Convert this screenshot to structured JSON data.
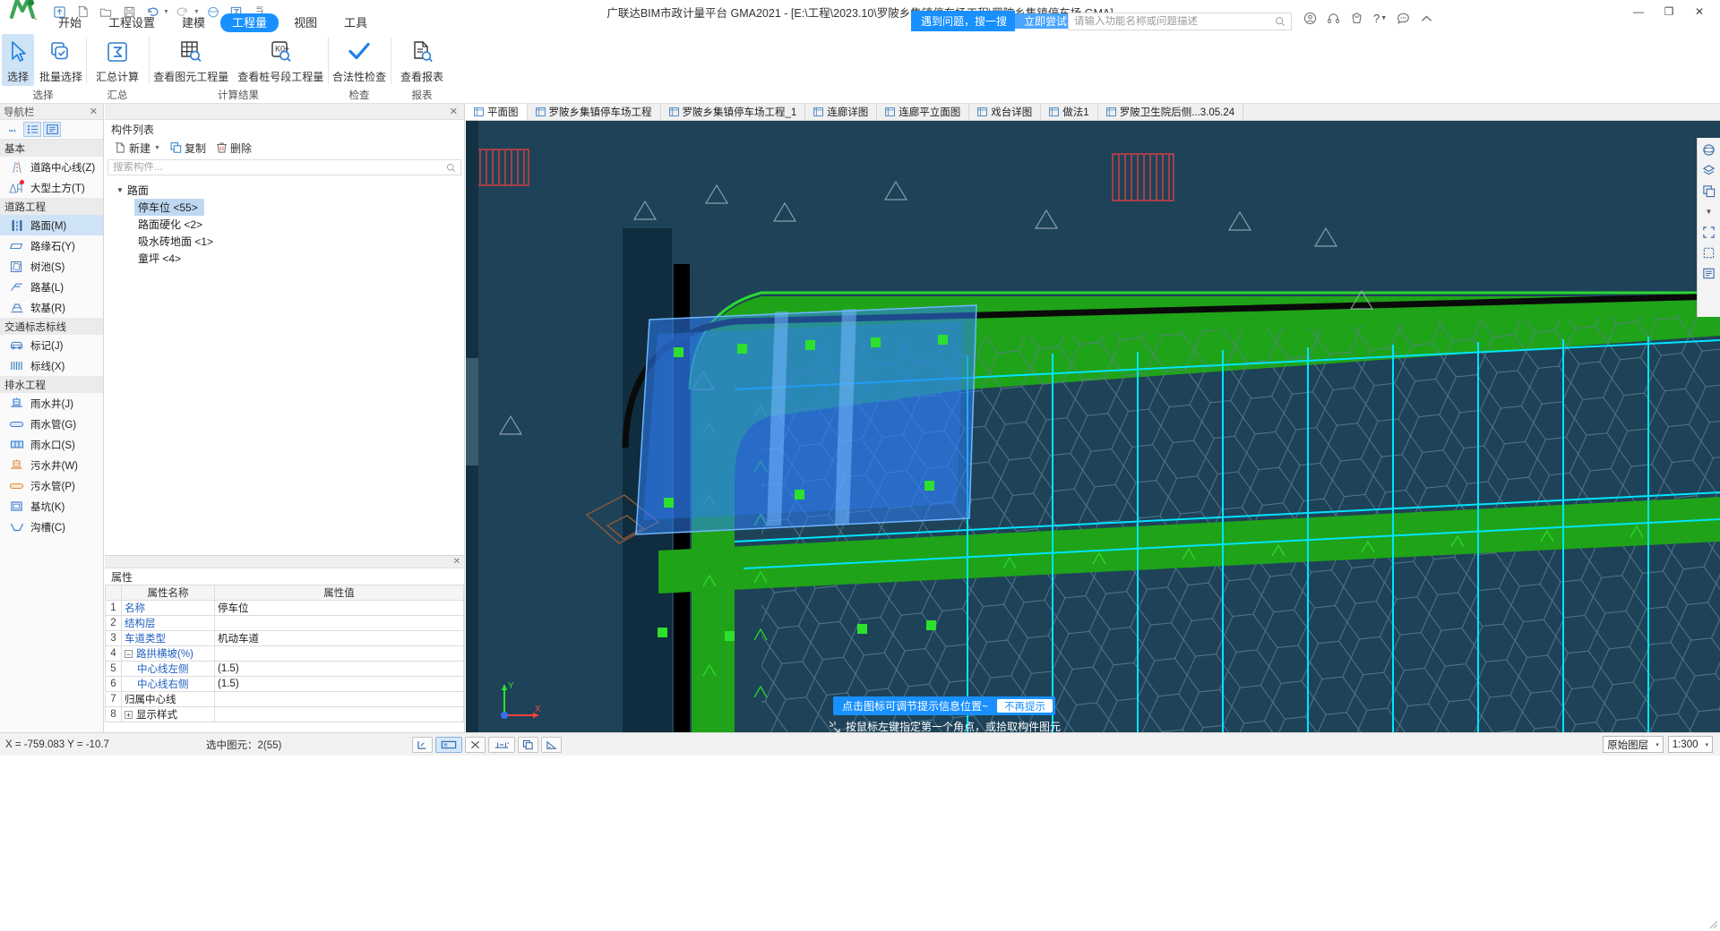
{
  "window": {
    "title": "广联达BIM市政计量平台 GMA2021 - [E:\\工程\\2023.10\\罗陂乡集镇停车场工程\\罗陂乡集镇停车场.GMA]",
    "minimize": "—",
    "maximize": "❐",
    "close": "✕"
  },
  "quick_access": [
    {
      "name": "upload-icon",
      "glyph": "⬆"
    },
    {
      "name": "new-file-icon",
      "glyph": "🗋"
    },
    {
      "name": "open-folder-icon",
      "glyph": "🗀"
    },
    {
      "name": "save-icon",
      "glyph": "💾"
    },
    {
      "name": "undo-icon",
      "glyph": "↺"
    },
    {
      "name": "redo-icon",
      "glyph": "↻"
    },
    {
      "name": "cloud-icon",
      "glyph": "◉"
    },
    {
      "name": "sum-icon",
      "glyph": "Σ"
    },
    {
      "name": "more-icon",
      "glyph": "⌄"
    }
  ],
  "menu": {
    "items": [
      {
        "label": "开始",
        "active": false
      },
      {
        "label": "工程设置",
        "active": false
      },
      {
        "label": "建模",
        "active": false
      },
      {
        "label": "工程量",
        "active": true
      },
      {
        "label": "视图",
        "active": false
      },
      {
        "label": "工具",
        "active": false
      }
    ]
  },
  "promo": {
    "text": "遇到问题，搜一搜",
    "button": "立即尝试"
  },
  "search": {
    "placeholder": "请输入功能名称或问题描述",
    "value": "",
    "icon": "search-icon"
  },
  "header_icons": [
    {
      "name": "user-account-icon",
      "glyph": "◎"
    },
    {
      "name": "headset-support-icon",
      "glyph": "⌾"
    },
    {
      "name": "gift-icon",
      "glyph": "♕"
    },
    {
      "name": "help-icon",
      "glyph": "?"
    },
    {
      "name": "feedback-icon",
      "glyph": "☺"
    },
    {
      "name": "collapse-ribbon-icon",
      "glyph": "⌃"
    }
  ],
  "ribbon": {
    "groups": [
      {
        "label": "选择",
        "buttons": [
          {
            "label": "选择",
            "icon": "cursor-arrow-icon",
            "selected": true
          },
          {
            "label": "批量选择",
            "icon": "batch-select-icon",
            "selected": false
          }
        ]
      },
      {
        "label": "汇总",
        "buttons": [
          {
            "label": "汇总计算",
            "icon": "sigma-calc-icon",
            "selected": false
          }
        ]
      },
      {
        "label": "计算结果",
        "buttons": [
          {
            "label": "查看图元工程量",
            "icon": "grid-search-icon",
            "selected": false
          },
          {
            "label": "查看桩号段工程量",
            "icon": "station-search-icon",
            "selected": false
          }
        ]
      },
      {
        "label": "检查",
        "buttons": [
          {
            "label": "合法性检查",
            "icon": "checkmark-icon",
            "selected": false
          }
        ]
      },
      {
        "label": "报表",
        "buttons": [
          {
            "label": "查看报表",
            "icon": "report-search-icon",
            "selected": false
          }
        ]
      }
    ]
  },
  "navigation": {
    "panel_title": "导航栏",
    "close_icon": "close-icon",
    "toolbar": [
      {
        "name": "collapse-all-icon",
        "glyph": "⎯",
        "active": false
      },
      {
        "name": "list-view-icon",
        "glyph": "☰",
        "active": true
      },
      {
        "name": "detail-view-icon",
        "glyph": "▤",
        "active": true
      }
    ],
    "sections": [
      {
        "title": "基本",
        "items": [
          {
            "label": "道路中心线(Z)",
            "icon": "road-centerline-icon",
            "selected": false,
            "badge": false
          },
          {
            "label": "大型土方(T)",
            "icon": "earthwork-icon",
            "selected": false,
            "badge": true
          }
        ]
      },
      {
        "title": "道路工程",
        "items": [
          {
            "label": "路面(M)",
            "icon": "pavement-icon",
            "selected": true,
            "badge": false
          },
          {
            "label": "路缘石(Y)",
            "icon": "curbstone-icon",
            "selected": false,
            "badge": false
          },
          {
            "label": "树池(S)",
            "icon": "tree-pit-icon",
            "selected": false,
            "badge": false
          },
          {
            "label": "路基(L)",
            "icon": "subgrade-icon",
            "selected": false,
            "badge": false
          },
          {
            "label": "软基(R)",
            "icon": "soft-foundation-icon",
            "selected": false,
            "badge": false
          }
        ]
      },
      {
        "title": "交通标志标线",
        "items": [
          {
            "label": "标记(J)",
            "icon": "traffic-sign-icon",
            "selected": false,
            "badge": false
          },
          {
            "label": "标线(X)",
            "icon": "road-marking-icon",
            "selected": false,
            "badge": false
          }
        ]
      },
      {
        "title": "排水工程",
        "items": [
          {
            "label": "雨水井(J)",
            "icon": "rain-manhole-icon",
            "selected": false,
            "badge": false
          },
          {
            "label": "雨水管(G)",
            "icon": "rain-pipe-icon",
            "selected": false,
            "badge": false
          },
          {
            "label": "雨水口(S)",
            "icon": "rain-inlet-icon",
            "selected": false,
            "badge": false
          },
          {
            "label": "污水井(W)",
            "icon": "sewer-manhole-icon",
            "selected": false,
            "badge": false
          },
          {
            "label": "污水管(P)",
            "icon": "sewer-pipe-icon",
            "selected": false,
            "badge": false
          },
          {
            "label": "基坑(K)",
            "icon": "foundation-pit-icon",
            "selected": false,
            "badge": false
          },
          {
            "label": "沟槽(C)",
            "icon": "trench-icon",
            "selected": false,
            "badge": false
          }
        ]
      }
    ]
  },
  "component_list": {
    "panel_title": "构件列表",
    "close_icon": "close-icon",
    "tools": [
      {
        "label": "新建",
        "icon": "new-component-icon",
        "has_caret": true
      },
      {
        "label": "复制",
        "icon": "copy-icon",
        "has_caret": false
      },
      {
        "label": "删除",
        "icon": "delete-icon",
        "has_caret": false
      }
    ],
    "search_placeholder": "搜索构件...",
    "search_value": "",
    "tree": [
      {
        "label": "路面",
        "expanded": true,
        "children": [
          {
            "label": "停车位  <55>",
            "selected": true
          },
          {
            "label": "路面硬化  <2>",
            "selected": false
          },
          {
            "label": "吸水砖地面  <1>",
            "selected": false
          },
          {
            "label": "童坪  <4>",
            "selected": false
          }
        ]
      }
    ]
  },
  "properties": {
    "panel_title": "属性",
    "close_icon": "close-icon",
    "columns": [
      "",
      "属性名称",
      "属性值"
    ],
    "rows": [
      {
        "no": "1",
        "name": "名称",
        "value": "停车位",
        "indent": 0,
        "link": true,
        "expander": ""
      },
      {
        "no": "2",
        "name": "结构层",
        "value": "",
        "indent": 0,
        "link": true,
        "expander": ""
      },
      {
        "no": "3",
        "name": "车道类型",
        "value": "机动车道",
        "indent": 0,
        "link": true,
        "expander": ""
      },
      {
        "no": "4",
        "name": "路拱横坡(%)",
        "value": "",
        "indent": 0,
        "link": true,
        "expander": "−"
      },
      {
        "no": "5",
        "name": "中心线左侧",
        "value": "(1.5)",
        "indent": 1,
        "link": true,
        "expander": ""
      },
      {
        "no": "6",
        "name": "中心线右侧",
        "value": "(1.5)",
        "indent": 1,
        "link": true,
        "expander": ""
      },
      {
        "no": "7",
        "name": "归属中心线",
        "value": "",
        "indent": 0,
        "link": false,
        "expander": ""
      },
      {
        "no": "8",
        "name": "显示样式",
        "value": "",
        "indent": 0,
        "link": false,
        "expander": "+"
      }
    ]
  },
  "document_tabs": [
    {
      "label": "平面图",
      "active": true,
      "icon": "drawing-icon"
    },
    {
      "label": "罗陂乡集镇停车场工程",
      "active": false,
      "icon": "drawing-icon"
    },
    {
      "label": "罗陂乡集镇停车场工程_1",
      "active": false,
      "icon": "drawing-icon"
    },
    {
      "label": "连廊详图",
      "active": false,
      "icon": "drawing-icon"
    },
    {
      "label": "连廊平立面图",
      "active": false,
      "icon": "drawing-icon"
    },
    {
      "label": "戏台详图",
      "active": false,
      "icon": "drawing-icon"
    },
    {
      "label": "做法1",
      "active": false,
      "icon": "drawing-icon"
    },
    {
      "label": "罗陂卫生院后侧...3.05.24",
      "active": false,
      "icon": "drawing-icon"
    }
  ],
  "viewport_tools": [
    {
      "name": "orbit-icon",
      "glyph": "◍"
    },
    {
      "name": "layer-icon",
      "glyph": "▤"
    },
    {
      "name": "copy-view-icon",
      "glyph": "❐"
    },
    {
      "name": "more-view-icon",
      "glyph": "⌄"
    },
    {
      "name": "fit-icon",
      "glyph": "⛶"
    },
    {
      "name": "zoom-window-icon",
      "glyph": "⬚"
    },
    {
      "name": "legend-icon",
      "glyph": "☰"
    }
  ],
  "canvas_hint": {
    "message": "点击图标可调节提示信息位置~",
    "dismiss": "不再提示",
    "command": "按鼠标左键指定第一个角点，或拾取构件图元",
    "command_icon": "crosshair-icon"
  },
  "status_bar": {
    "coordinates": "X = -759.083  Y = -10.7",
    "selection": "选中图元：2(55)",
    "tools": [
      {
        "name": "orthogonal-icon",
        "glyph": "⌐",
        "active": false
      },
      {
        "name": "selection-mode-icon",
        "glyph": "▭",
        "active": true
      },
      {
        "name": "clear-selection-icon",
        "glyph": "✕",
        "active": false
      },
      {
        "name": "snap-icon",
        "glyph": "⊹",
        "active": false
      },
      {
        "name": "copy-element-icon",
        "glyph": "❐",
        "active": false
      },
      {
        "name": "measure-icon",
        "glyph": "⊿",
        "active": false
      }
    ],
    "layer_select": {
      "value": "原始图层",
      "caret": "▾"
    },
    "scale_select": {
      "value": "1:300",
      "caret": "▾"
    }
  },
  "colors": {
    "accent": "#1890ff",
    "selection": "#cfe3f7",
    "canvas_bg": "#1e4258",
    "grass_green": "#1fa318",
    "highlight_blue": "#2f7ff5",
    "marker_green": "#2ee02e",
    "cyan_line": "#00e5ff"
  }
}
